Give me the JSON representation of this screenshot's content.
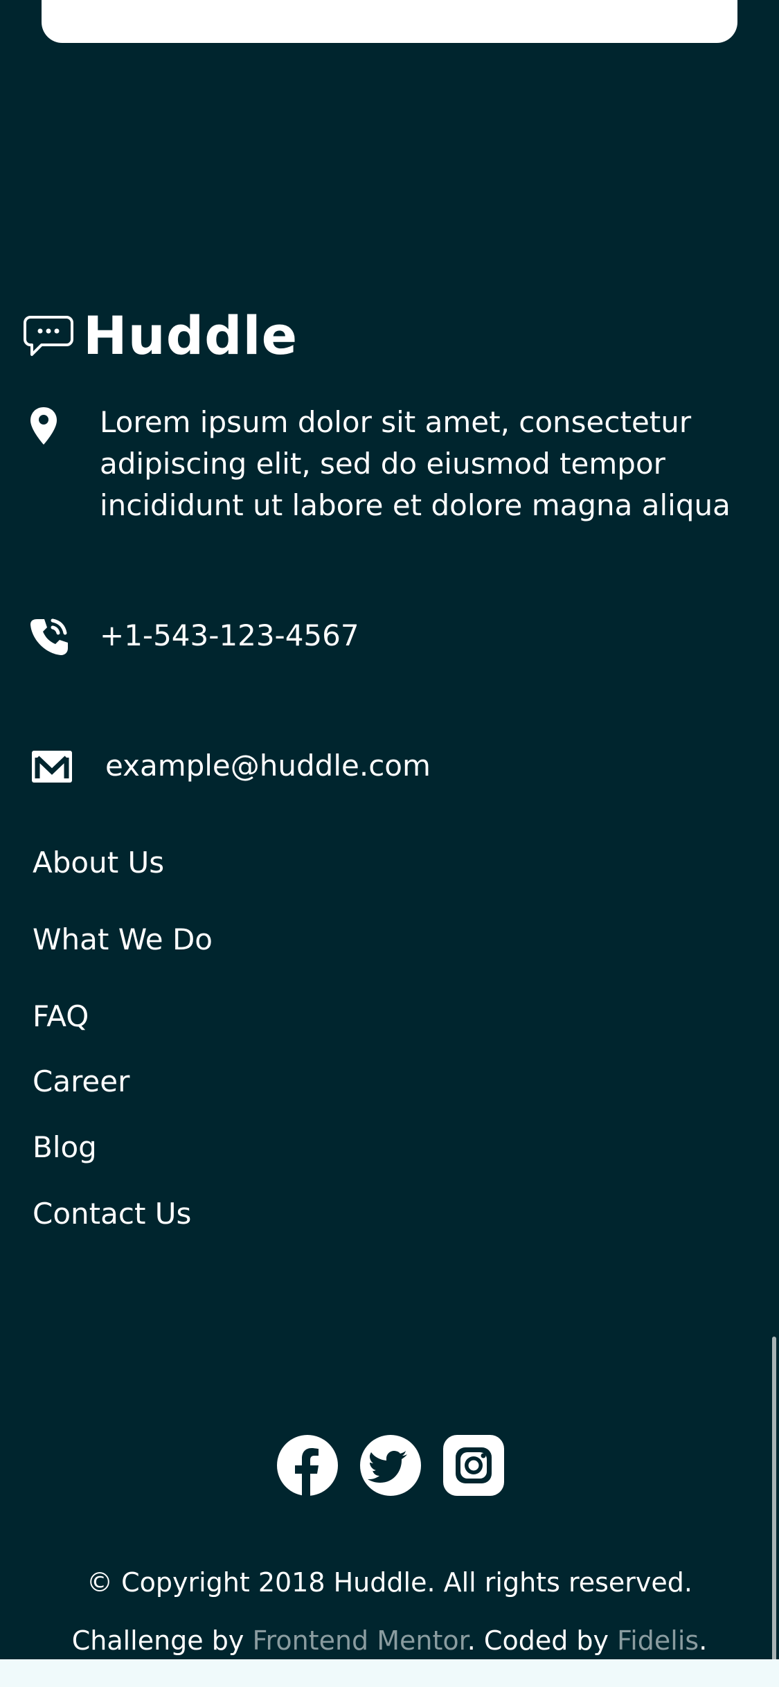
{
  "colors": {
    "background": "#00252e",
    "text": "#ffffff",
    "link_muted": "#8a9ca0",
    "bottom_strip": "#f0fafb"
  },
  "brand": {
    "logo_icon": "chat-bubble-icon",
    "name": "Huddle"
  },
  "contact": {
    "address_icon": "location-pin-icon",
    "address_lines": [
      "Lorem ipsum dolor sit amet, consectetur",
      "adipiscing elit, sed do eiusmod tempor",
      "incididunt ut labore et dolore magna aliqua"
    ],
    "phone_icon": "phone-icon",
    "phone": "+1-543-123-4567",
    "email_icon": "mail-icon",
    "email": "example@huddle.com"
  },
  "nav": {
    "items": [
      {
        "label": "About Us"
      },
      {
        "label": "What We Do"
      },
      {
        "label": "FAQ"
      },
      {
        "label": "Career"
      },
      {
        "label": "Blog"
      },
      {
        "label": "Contact Us"
      }
    ]
  },
  "social": {
    "icons": [
      "facebook-icon",
      "twitter-icon",
      "instagram-icon"
    ]
  },
  "footer": {
    "copyright": "© Copyright 2018 Huddle. All rights reserved.",
    "credit_prefix": "Challenge by ",
    "credit_link1": "Frontend Mentor",
    "credit_middle": ". Coded by ",
    "credit_link2": "Fidelis",
    "credit_suffix": "."
  }
}
